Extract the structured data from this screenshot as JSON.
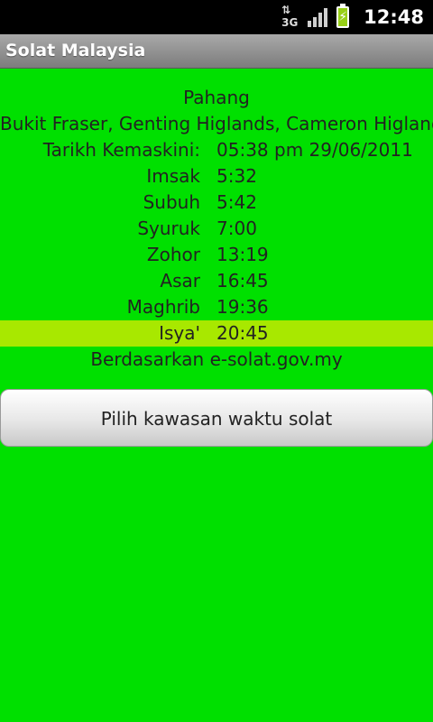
{
  "status_bar": {
    "network_label": "3G",
    "network_arrows": "⇅",
    "time": "12:48",
    "battery_color": "#98d017"
  },
  "app": {
    "title": "Solat Malaysia"
  },
  "location": {
    "state": "Pahang",
    "zone": "Bukit Fraser, Genting Higlands, Cameron Higlands"
  },
  "updated": {
    "label": "Tarikh Kemaskini:",
    "value": "05:38 pm 29/06/2011"
  },
  "prayers": [
    {
      "name": "Imsak",
      "time": "5:32"
    },
    {
      "name": "Subuh",
      "time": "5:42"
    },
    {
      "name": "Syuruk",
      "time": "7:00"
    },
    {
      "name": "Zohor",
      "time": "13:19"
    },
    {
      "name": "Asar",
      "time": "16:45"
    },
    {
      "name": "Maghrib",
      "time": "19:36"
    },
    {
      "name": "Isya'",
      "time": "20:45"
    }
  ],
  "source_text": "Berdasarkan e-solat.gov.my",
  "pick_zone_button": "Pilih kawasan waktu solat",
  "colors": {
    "background": "#00e000",
    "highlight": "#a8e800"
  }
}
